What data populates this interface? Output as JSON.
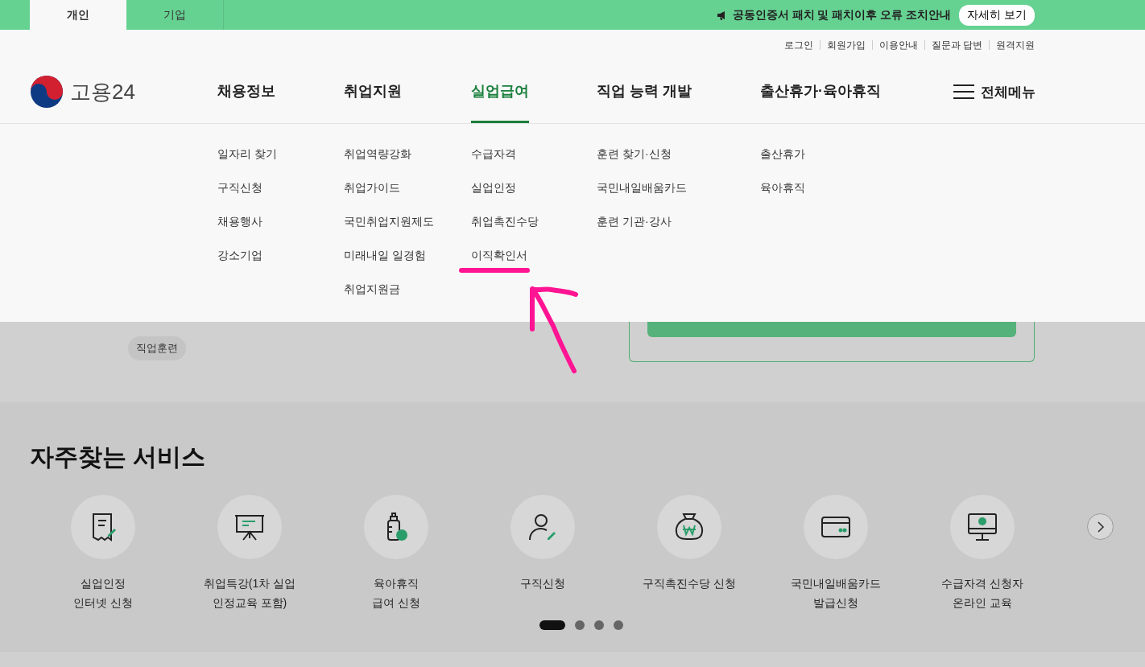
{
  "top_bar": {
    "tabs": [
      {
        "label": "개인",
        "selected": true
      },
      {
        "label": "기업",
        "selected": false
      }
    ],
    "notice": {
      "text": "공동인증서 패치 및 패치이후 오류 조치안내",
      "button": "자세히 보기"
    }
  },
  "util_links": [
    "로그인",
    "회원가입",
    "이용안내",
    "질문과 답변",
    "원격지원"
  ],
  "logo": "고용24",
  "nav": [
    {
      "label": "채용정보",
      "selected": false
    },
    {
      "label": "취업지원",
      "selected": false
    },
    {
      "label": "실업급여",
      "selected": true
    },
    {
      "label": "직업 능력 개발",
      "selected": false
    },
    {
      "label": "출산휴가·육아휴직",
      "selected": false
    }
  ],
  "all_menu": "전체메뉴",
  "mega_menu": [
    [
      "일자리 찾기",
      "구직신청",
      "채용행사",
      "강소기업"
    ],
    [
      "취업역량강화",
      "취업가이드",
      "국민취업지원제도",
      "미래내일 일경험",
      "취업지원금"
    ],
    [
      "수급자격",
      "실업인정",
      "취업촉진수당",
      "이직확인서"
    ],
    [
      "훈련 찾기·신청",
      "국민내일배움카드",
      "훈련 기관·강사"
    ],
    [
      "출산휴가",
      "육아휴직"
    ]
  ],
  "chips": [
    "직업훈련"
  ],
  "services": {
    "title": "자주찾는 서비스",
    "items": [
      {
        "lines": [
          "실업인정",
          "인터넷 신청"
        ]
      },
      {
        "lines": [
          "취업특강(1차 실업",
          "인정교육 포함)"
        ]
      },
      {
        "lines": [
          "육아휴직",
          "급여 신청"
        ]
      },
      {
        "lines": [
          "구직신청"
        ]
      },
      {
        "lines": [
          "구직촉진수당 신청"
        ]
      },
      {
        "lines": [
          "국민내일배움카드",
          "발급신청"
        ]
      },
      {
        "lines": [
          "수급자격 신청자",
          "온라인 교육"
        ]
      }
    ],
    "dots": [
      {
        "selected": true
      },
      {
        "selected": false
      },
      {
        "selected": false
      },
      {
        "selected": false
      }
    ]
  }
}
